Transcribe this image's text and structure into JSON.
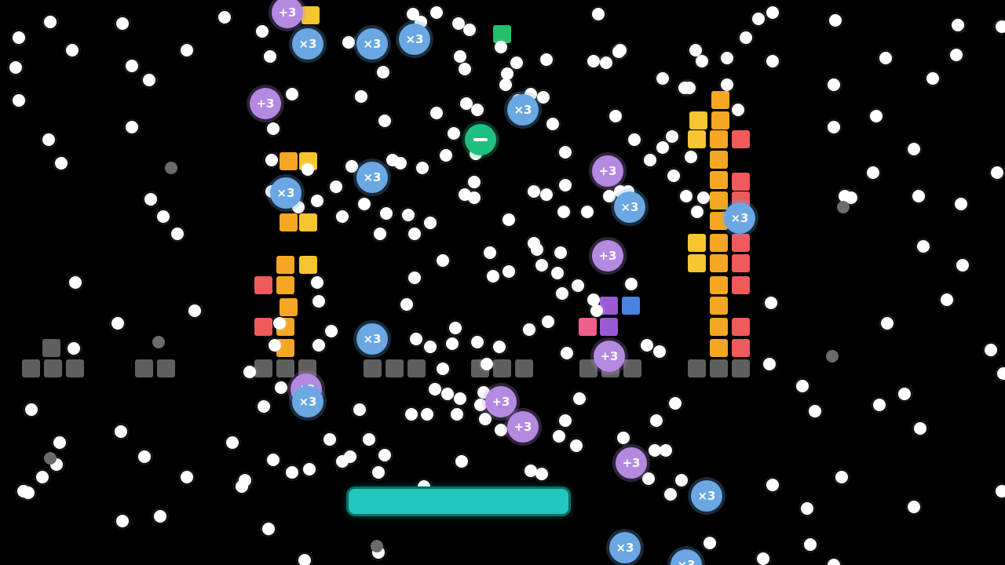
{
  "colors": {
    "background": "#000000",
    "paddle": "#22c7bd",
    "ball": "#ffffff",
    "multiply_powerup": "#6aa7e3",
    "add_powerup": "#b38ae0",
    "shrink_powerup": "#1fc07e",
    "steel_block": "#5f5f5f"
  },
  "powerups": {
    "multiply_label": "×3",
    "add_label": "+3"
  },
  "icons": {
    "shrink": "minus-icon"
  }
}
